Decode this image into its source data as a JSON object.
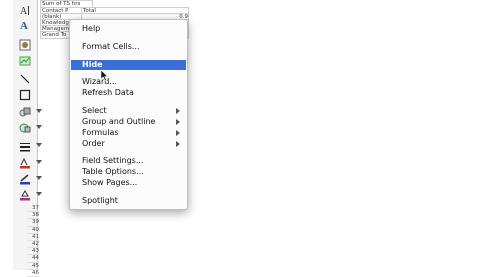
{
  "sheet": {
    "rows": [
      [
        "Sum of TS hrs",
        ""
      ],
      [
        "Contact P",
        "Total"
      ],
      [
        "(blank)",
        "0.9"
      ],
      [
        "Knowledge",
        ""
      ],
      [
        "Managem",
        ""
      ],
      [
        "Grand To",
        ""
      ]
    ],
    "row_numbers": [
      "37",
      "38",
      "39",
      "40",
      "41",
      "42",
      "43",
      "44",
      "45",
      "46"
    ]
  },
  "menu": {
    "items": [
      {
        "label": "Help"
      },
      {
        "label": "Format Cells..."
      },
      {
        "label": "Hide",
        "highlighted": true
      },
      {
        "label": "Wizard..."
      },
      {
        "label": "Refresh Data"
      },
      {
        "label": "Select",
        "submenu": true
      },
      {
        "label": "Group and Outline",
        "submenu": true
      },
      {
        "label": "Formulas",
        "submenu": true
      },
      {
        "label": "Order",
        "submenu": true
      },
      {
        "label": "Field Settings..."
      },
      {
        "label": "Table Options..."
      },
      {
        "label": "Show Pages..."
      },
      {
        "label": "Spotlight"
      }
    ],
    "highlight_color": "#3a6fd8"
  },
  "toolbar": {
    "tools": [
      "text-tool-icon",
      "text-style-icon",
      "image-icon",
      "chart-icon",
      "line-icon",
      "rectangle-icon",
      "shapes-icon",
      "clip-art-icon",
      "line-style-icon",
      "text-color-icon",
      "line-color-icon",
      "fill-color-icon"
    ]
  }
}
